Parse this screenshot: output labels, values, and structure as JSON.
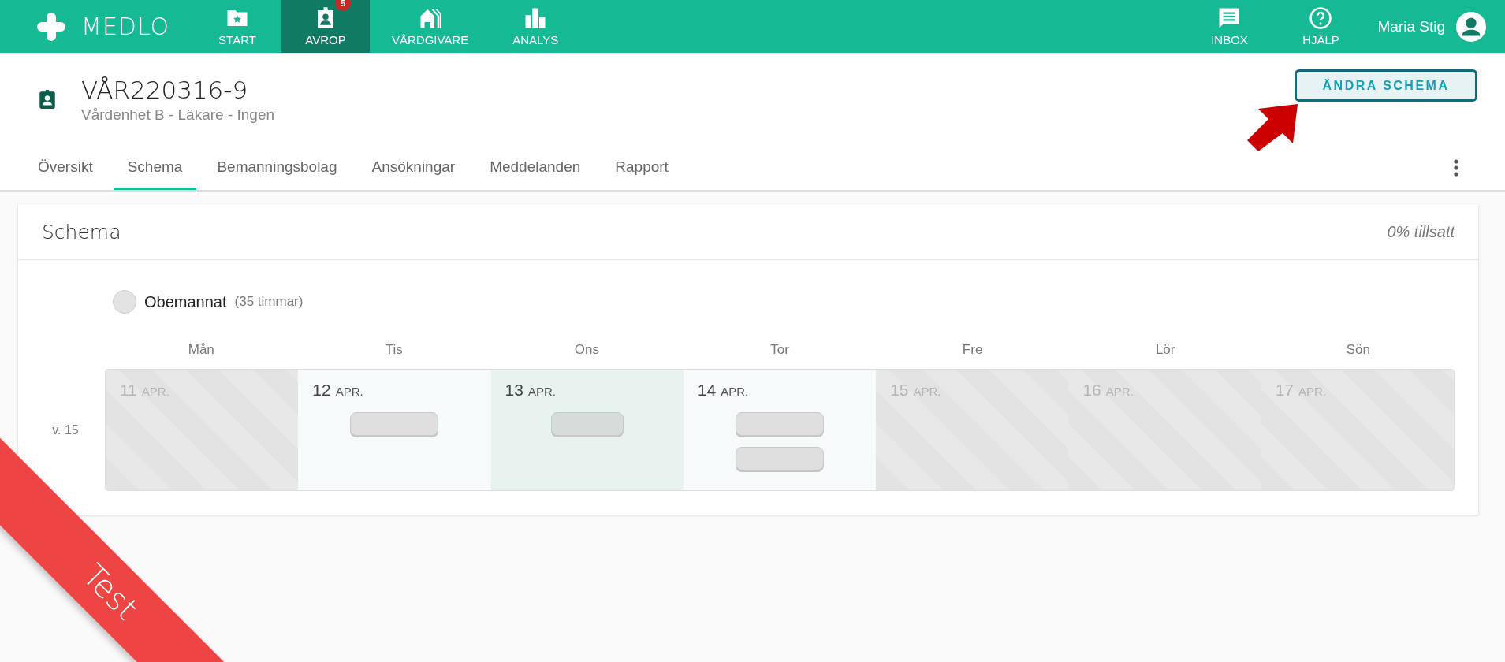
{
  "topbar": {
    "logo": "MEDLO",
    "nav": [
      {
        "label": "START",
        "selected": false
      },
      {
        "label": "AVROP",
        "selected": true,
        "badge": "5"
      },
      {
        "label": "VÅRDGIVARE",
        "selected": false
      },
      {
        "label": "ANALYS",
        "selected": false
      }
    ],
    "actions": [
      {
        "label": "INBOX"
      },
      {
        "label": "HJÄLP"
      }
    ],
    "user": "Maria Stig"
  },
  "header": {
    "title": "VÅR220316-9",
    "subtitle": "Vårdenhet B - Läkare - Ingen",
    "button": "ÄNDRA SCHEMA"
  },
  "tabs": [
    {
      "label": "Översikt",
      "selected": false
    },
    {
      "label": "Schema",
      "selected": true
    },
    {
      "label": "Bemanningsbolag",
      "selected": false
    },
    {
      "label": "Ansökningar",
      "selected": false
    },
    {
      "label": "Meddelanden",
      "selected": false
    },
    {
      "label": "Rapport",
      "selected": false
    }
  ],
  "schedule": {
    "title": "Schema",
    "filled": "0% tillsatt",
    "legend": {
      "label": "Obemannat",
      "hours": "(35 timmar)"
    },
    "weekdays": [
      "Mån",
      "Tis",
      "Ons",
      "Tor",
      "Fre",
      "Lör",
      "Sön"
    ],
    "weeks": [
      {
        "label": "v. 15",
        "days": [
          {
            "day": "11",
            "month": "APR.",
            "disabled": true,
            "highlighted": false
          },
          {
            "day": "12",
            "month": "APR.",
            "disabled": false,
            "highlighted": false,
            "shifts": [
              {
                "filled": false
              }
            ]
          },
          {
            "day": "13",
            "month": "APR.",
            "disabled": false,
            "highlighted": true,
            "shifts": [
              {
                "filled": false
              }
            ]
          },
          {
            "day": "14",
            "month": "APR.",
            "disabled": false,
            "highlighted": false,
            "shifts": [
              {
                "filled": false
              },
              {
                "filled": false
              }
            ]
          },
          {
            "day": "15",
            "month": "APR.",
            "disabled": true,
            "highlighted": false
          },
          {
            "day": "16",
            "month": "APR.",
            "disabled": true,
            "highlighted": false
          },
          {
            "day": "17",
            "month": "APR.",
            "disabled": true,
            "highlighted": false
          }
        ]
      }
    ]
  },
  "ribbon": "Test"
}
